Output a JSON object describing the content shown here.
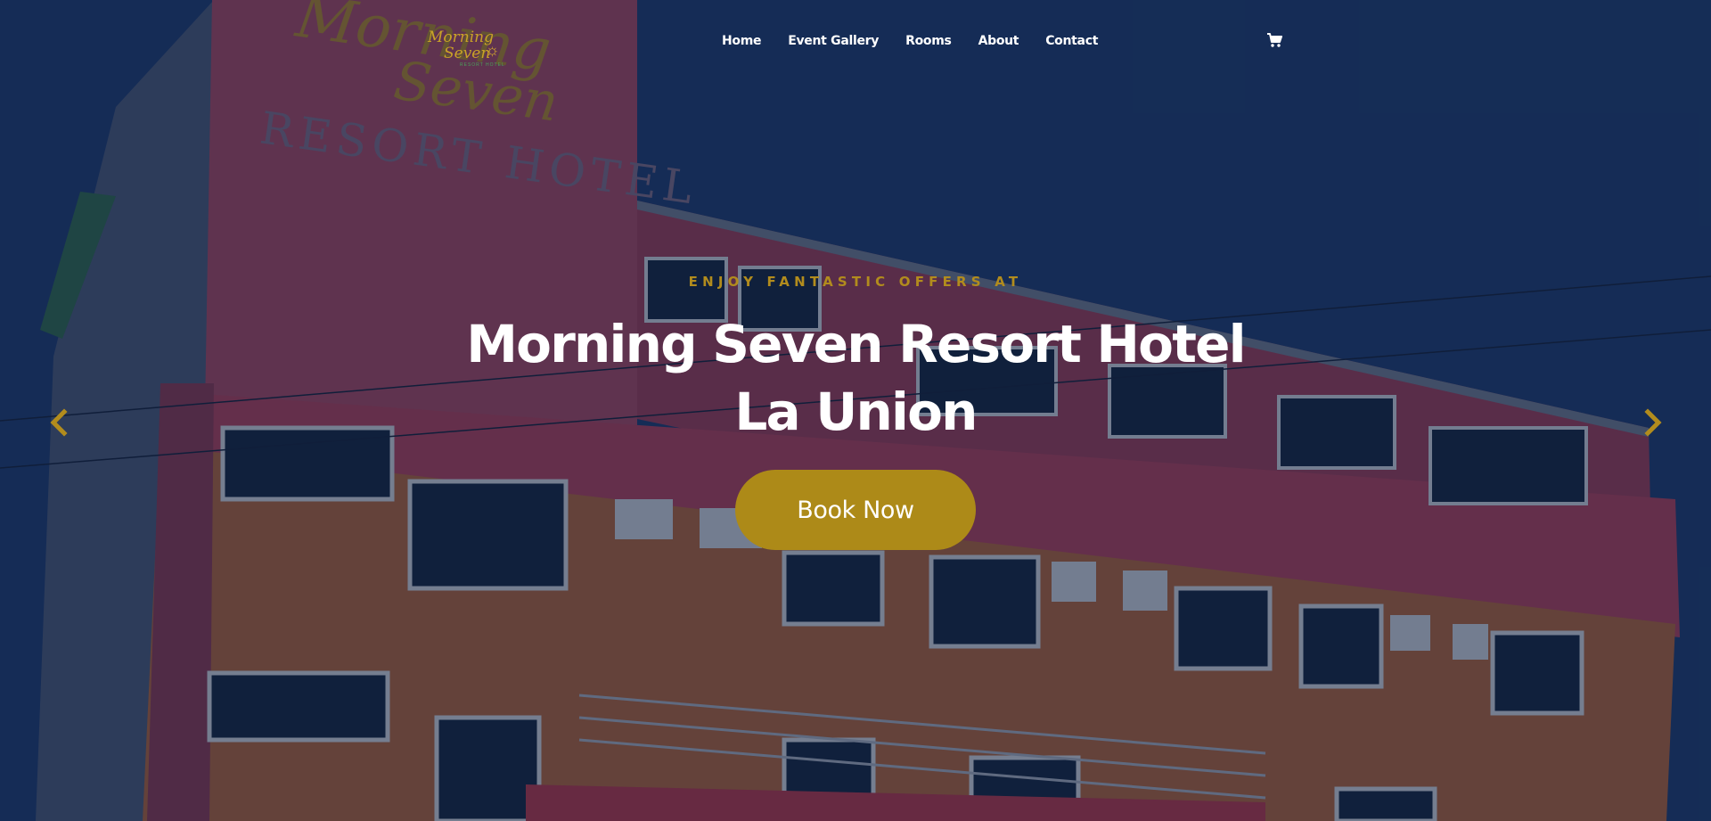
{
  "brand": {
    "logo_line1": "Morning",
    "logo_line2": "Seven",
    "logo_tagline": "RESORT HOTEL"
  },
  "nav": {
    "items": [
      {
        "label": "Home"
      },
      {
        "label": "Event Gallery"
      },
      {
        "label": "Rooms"
      },
      {
        "label": "About"
      },
      {
        "label": "Contact"
      }
    ],
    "cart_icon": "shopping-cart-icon"
  },
  "hero": {
    "eyebrow": "ENJOY FANTASTIC OFFERS AT",
    "title_line1": "Morning Seven Resort Hotel",
    "title_line2": "La Union",
    "cta_label": "Book Now",
    "background_image": "building facade with sign",
    "sign_text": "RESORT HOTEL"
  },
  "carousel": {
    "prev_icon": "chevron-left-icon",
    "next_icon": "chevron-right-icon"
  },
  "colors": {
    "accent_gold": "#ad8a18",
    "eyebrow_gold": "#b28c1d",
    "text_white": "#ffffff",
    "overlay_navy": "#0e1c3a"
  }
}
